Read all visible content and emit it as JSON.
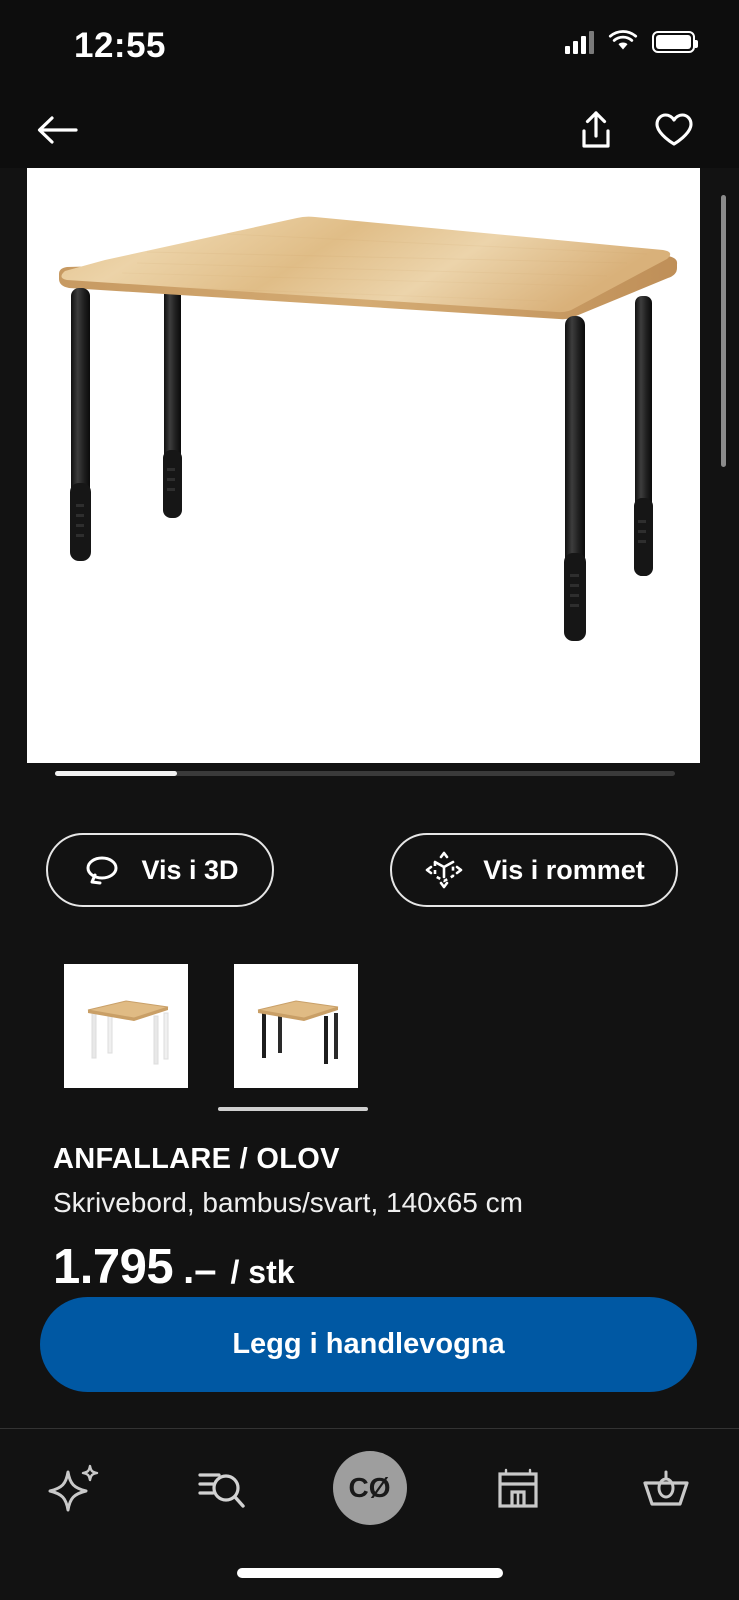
{
  "status_bar": {
    "time": "12:55",
    "cellular_icon": "signal-bars-icon",
    "wifi_icon": "wifi-icon",
    "battery_icon": "battery-icon"
  },
  "nav_bar": {
    "back_icon": "back-arrow-icon",
    "share_icon": "share-icon",
    "favorite_icon": "heart-icon"
  },
  "gallery": {
    "main_image_alt": "ANFALLARE / OLOV desk, bamboo top with black legs",
    "carousel_position": "1",
    "thumbnails": [
      {
        "alt": "Desk with white legs",
        "selected": false
      },
      {
        "alt": "Desk with black legs",
        "selected": true
      }
    ]
  },
  "view_buttons": {
    "view_3d": {
      "label": "Vis i 3D",
      "icon": "rotate-3d-icon"
    },
    "view_room": {
      "label": "Vis i rommet",
      "icon": "ar-cube-icon"
    }
  },
  "product": {
    "name": "ANFALLARE / OLOV",
    "description": "Skrivebord, bambus/svart, 140x65 cm",
    "price": "1.795",
    "price_suffix": ".–",
    "price_unit": "/ stk"
  },
  "cta": {
    "add_to_cart_label": "Legg i handlevogna"
  },
  "tab_bar": {
    "items": [
      {
        "name": "inspiration",
        "icon": "sparkle-icon",
        "active": false
      },
      {
        "name": "search",
        "icon": "search-list-icon",
        "active": false
      },
      {
        "name": "profile",
        "icon": "avatar-icon",
        "initials": "CØ",
        "active": true
      },
      {
        "name": "store",
        "icon": "store-icon",
        "active": false
      },
      {
        "name": "cart",
        "icon": "basket-icon",
        "active": false
      }
    ]
  },
  "colors": {
    "background": "#121212",
    "status_background": "#0d0d0d",
    "cta_blue": "#0058a3",
    "text_primary": "#ffffff",
    "avatar_gray": "#9e9e9e",
    "bamboo": "#ddb77f"
  }
}
